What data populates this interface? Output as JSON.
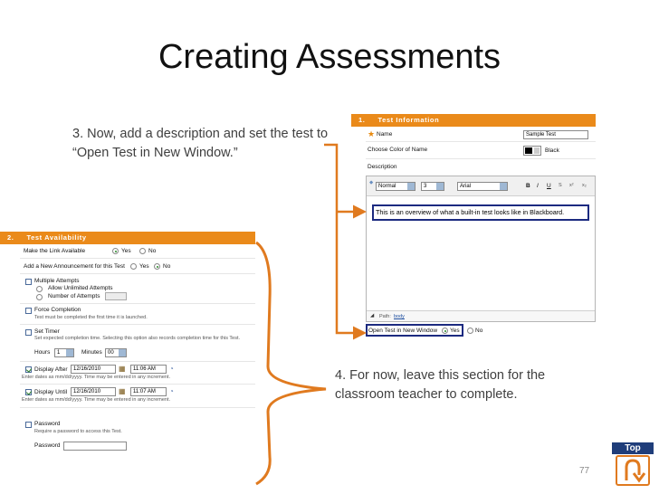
{
  "slide": {
    "title": "Creating Assessments",
    "callout_3": "3. Now, add a description and set the test to “Open Test in New Window.”",
    "callout_4": "4. For now, leave this section for the classroom teacher to complete.",
    "page_number": "77",
    "top_label": "Top"
  },
  "test_information": {
    "section_number": "1.",
    "section_title": "Test Information",
    "name_label": "Name",
    "name_value": "Sample Test",
    "color_label": "Choose Color of Name",
    "color_value": "Black",
    "description_label": "Description",
    "toolbar": {
      "style": "Normal",
      "size": "3",
      "font": "Arial",
      "bold": "B",
      "italic": "I",
      "underline": "U"
    },
    "description_text": "This is an overview of what a built-in test looks like in Blackboard.",
    "path_label": "Path:",
    "path_value": "body",
    "open_new_window_label": "Open Test in New Window",
    "yes_label": "Yes",
    "no_label": "No",
    "accent": "#ea8a1a"
  },
  "test_availability": {
    "section_number": "2.",
    "section_title": "Test Availability",
    "make_available_label": "Make the Link Available",
    "announcement_label": "Add a New Announcement for this Test",
    "yes_label": "Yes",
    "no_label": "No",
    "multiple_attempts": "Multiple Attempts",
    "allow_unlimited": "Allow Unlimited Attempts",
    "number_of_attempts": "Number of Attempts",
    "force_completion": "Force Completion",
    "force_completion_help": "Test must be completed the first time it is launched.",
    "set_timer": "Set Timer",
    "set_timer_help": "Set expected completion time. Selecting this option also records completion time for this Test.",
    "hours_label": "Hours",
    "hours_value": "1",
    "minutes_label": "Minutes",
    "minutes_value": "00",
    "display_after": "Display After",
    "display_after_date": "12/16/2010",
    "display_after_time": "11:06 AM",
    "display_after_help": "Enter dates as mm/dd/yyyy. Time may be entered in any increment.",
    "display_until": "Display Until",
    "display_until_date": "12/16/2010",
    "display_until_time": "11:07 AM",
    "display_until_help": "Enter dates as mm/dd/yyyy. Time may be entered in any increment.",
    "password": "Password",
    "password_help": "Require a password to access this Test.",
    "password_label": "Password"
  },
  "colors": {
    "accent_orange": "#e07a1f",
    "highlight_navy": "#1c2a80",
    "top_button_blue": "#1f3d7a"
  }
}
